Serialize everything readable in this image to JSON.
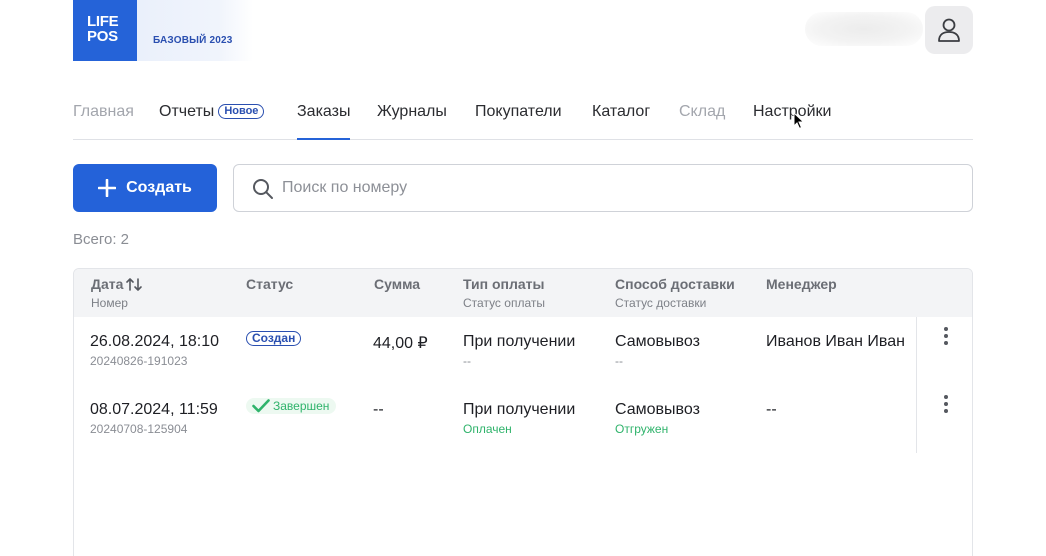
{
  "brand": {
    "logo_line1": "LIFE",
    "logo_line2": "POS",
    "plan": "БАЗОВЫЙ 2023"
  },
  "nav": {
    "items": [
      {
        "label": "Главная",
        "state": "disabled"
      },
      {
        "label": "Отчеты",
        "badge": "Новое"
      },
      {
        "label": "Заказы",
        "state": "active"
      },
      {
        "label": "Журналы"
      },
      {
        "label": "Покупатели"
      },
      {
        "label": "Каталог"
      },
      {
        "label": "Склад",
        "state": "disabled"
      },
      {
        "label": "Настройки"
      }
    ]
  },
  "toolbar": {
    "create_label": "Создать",
    "search_placeholder": "Поиск по номеру",
    "search_value": ""
  },
  "total": "Всего: 2",
  "table": {
    "columns": [
      {
        "title": "Дата",
        "subtitle": "Номер",
        "sortable": true
      },
      {
        "title": "Статус",
        "subtitle": ""
      },
      {
        "title": "Сумма",
        "subtitle": ""
      },
      {
        "title": "Тип оплаты",
        "subtitle": "Статус оплаты"
      },
      {
        "title": "Способ доставки",
        "subtitle": "Статус доставки"
      },
      {
        "title": "Менеджер",
        "subtitle": ""
      }
    ],
    "rows": [
      {
        "date": "26.08.2024, 18:10",
        "number": "20240826-191023",
        "status": "Создан",
        "status_kind": "created",
        "sum": "44,00 ₽",
        "payment_type": "При получении",
        "payment_status": "--",
        "delivery": "Самовывоз",
        "delivery_status": "--",
        "manager": "Иванов Иван Иван"
      },
      {
        "date": "08.07.2024, 11:59",
        "number": "20240708-125904",
        "status": "Завершен",
        "status_kind": "done",
        "sum": "--",
        "payment_type": "При получении",
        "payment_status": "Оплачен",
        "delivery": "Самовывоз",
        "delivery_status": "Отгружен",
        "manager": "--"
      }
    ]
  },
  "colors": {
    "accent": "#2462d9",
    "success": "#2fb36b",
    "badge": "#2a4fb0"
  }
}
